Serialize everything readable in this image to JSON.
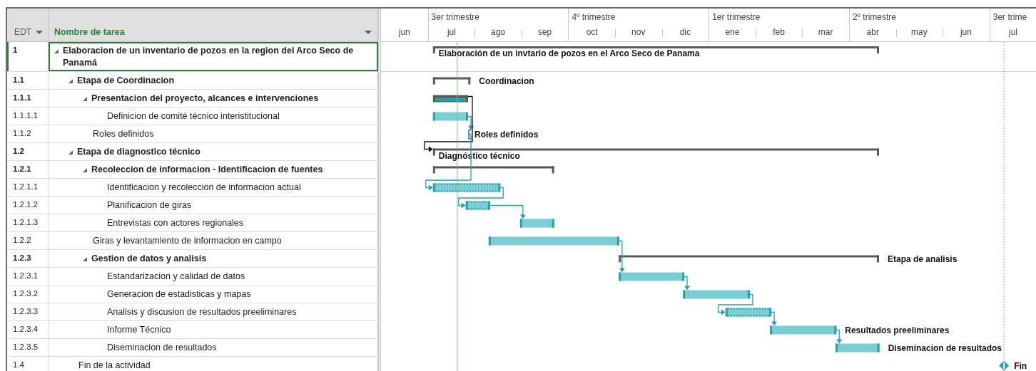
{
  "table": {
    "columns": [
      {
        "label": "EDT"
      },
      {
        "label": "Nombre de tarea"
      }
    ]
  },
  "timescale": {
    "quarters": [
      {
        "label": "3er trimestre"
      },
      {
        "label": "4º trimestre"
      },
      {
        "label": "1er trimestre"
      },
      {
        "label": "2º trimestre"
      },
      {
        "label": "3er trime"
      }
    ],
    "months": [
      "jun",
      "jul",
      "ago",
      "sep",
      "oct",
      "nov",
      "dic",
      "ene",
      "feb",
      "mar",
      "abr",
      "may",
      "jun",
      "jul"
    ]
  },
  "tasks": [
    {
      "edt": "1",
      "name": "Elaboracion de un inventario de pozos en la region del Arco Seco de Panamá",
      "expanded": true,
      "selected": true,
      "bar": {
        "kind": "summary",
        "label": "Elaboración de un invtario de pozos en el Arco Seco de Panama",
        "linked": false
      },
      "children": [
        {
          "edt": "1.1",
          "name": "Etapa de Coordinacion",
          "expanded": true,
          "selected": false,
          "bar": {
            "kind": "summary",
            "label": "Coordinacion",
            "linked": false
          },
          "children": [
            {
              "edt": "1.1.1",
              "name": "Presentacion del proyecto, alcances e intervenciones",
              "expanded": true,
              "selected": false,
              "bar": {
                "kind": "manual-summary",
                "linked": false
              },
              "children": [
                {
                  "edt": "1.1.1.1",
                  "name": "Definicion de comité técnico interistitucional",
                  "selected": false,
                  "bar": {
                    "kind": "task",
                    "linked": false
                  }
                }
              ]
            },
            {
              "edt": "1.1.2",
              "name": "Roles definidos",
              "selected": false,
              "bar": {
                "kind": "start-only",
                "label": "Roles definidos",
                "linked": true
              }
            }
          ]
        },
        {
          "edt": "1.2",
          "name": "Etapa de diagnostico técnico",
          "expanded": true,
          "selected": false,
          "bar": {
            "kind": "summary",
            "label": "Diagnóstico técnico",
            "linked": true
          },
          "children": [
            {
              "edt": "1.2.1",
              "name": "Recoleccion de informacion - Identificacion de fuentes",
              "expanded": true,
              "selected": false,
              "bar": {
                "kind": "summary",
                "linked": false
              },
              "children": [
                {
                  "edt": "1.2.1.1",
                  "name": "Identificacion y recoleccion de informacion actual",
                  "selected": false,
                  "bar": {
                    "kind": "dotted",
                    "linked": true
                  }
                },
                {
                  "edt": "1.2.1.2",
                  "name": "Planificacion de giras",
                  "selected": false,
                  "bar": {
                    "kind": "dotted",
                    "linked": true
                  }
                },
                {
                  "edt": "1.2.1.3",
                  "name": "Entrevistas con actores regionales",
                  "selected": false,
                  "bar": {
                    "kind": "task",
                    "linked": true
                  }
                }
              ]
            },
            {
              "edt": "1.2.2",
              "name": "Giras y levantamiento de informacion en campo",
              "selected": false,
              "bar": {
                "kind": "task",
                "linked": false
              }
            },
            {
              "edt": "1.2.3",
              "name": "Gestion de datos y analisis",
              "expanded": true,
              "selected": false,
              "bar": {
                "kind": "summary",
                "label": "Etapa de analisis",
                "linked": false
              },
              "children": [
                {
                  "edt": "1.2.3.1",
                  "name": "Estandarizacion y calidad de datos",
                  "selected": false,
                  "bar": {
                    "kind": "task",
                    "linked": true
                  }
                },
                {
                  "edt": "1.2.3.2",
                  "name": "Generacion de estadisticas y mapas",
                  "selected": false,
                  "bar": {
                    "kind": "task",
                    "linked": true
                  }
                },
                {
                  "edt": "1.2.3.3",
                  "name": "Analisis y discusion de resultados preeliminares",
                  "selected": false,
                  "bar": {
                    "kind": "dotted",
                    "linked": true
                  }
                },
                {
                  "edt": "1.2.3.4",
                  "name": "Informe Técnico",
                  "selected": false,
                  "bar": {
                    "kind": "task",
                    "label": "Resultados preeliminares",
                    "linked": true
                  }
                },
                {
                  "edt": "1.2.3.5",
                  "name": "Diseminacion de resultados",
                  "selected": false,
                  "bar": {
                    "kind": "task",
                    "label": "Diseminacion de resultados",
                    "linked": true
                  }
                }
              ]
            }
          ]
        },
        {
          "edt": "1.4",
          "name": "Fin de la actividad",
          "selected": false,
          "bar": {
            "kind": "milestone",
            "label": "Fin",
            "linked": false
          }
        }
      ]
    }
  ]
}
